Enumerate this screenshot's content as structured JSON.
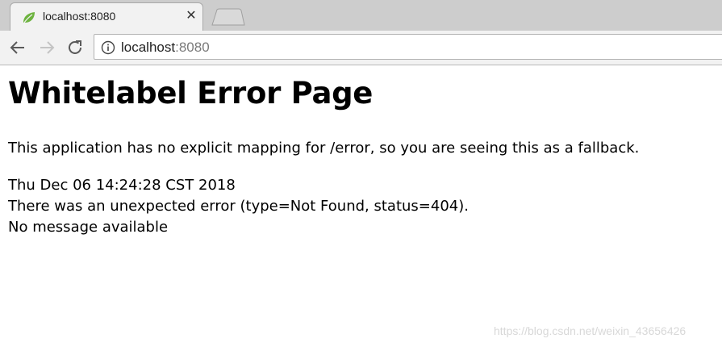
{
  "browser": {
    "tab": {
      "title": "localhost:8080",
      "favicon": "spring-leaf-icon",
      "close_glyph": "✕"
    },
    "address_bar": {
      "host": "localhost",
      "port": ":8080",
      "security_icon": "info-icon"
    },
    "nav_icons": [
      "back-arrow-icon",
      "forward-arrow-icon",
      "reload-icon"
    ]
  },
  "page": {
    "heading": "Whitelabel Error Page",
    "description": "This application has no explicit mapping for /error, so you are seeing this as a fallback.",
    "timestamp": "Thu Dec 06 14:24:28 CST 2018",
    "error_line": "There was an unexpected error (type=Not Found, status=404).",
    "message": "No message available"
  },
  "watermark": "https://blog.csdn.net/weixin_43656426",
  "colors": {
    "tabstrip": "#cdcdcd",
    "toolbar": "#f2f2f2",
    "favicon": "#6db33f"
  }
}
